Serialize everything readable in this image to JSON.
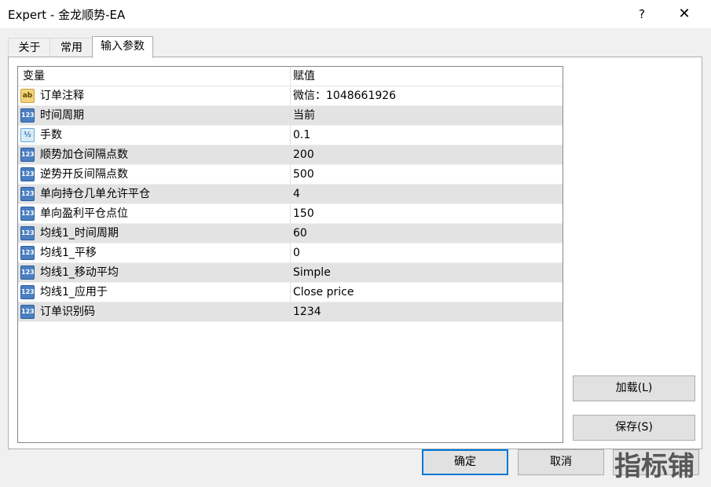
{
  "window": {
    "title": "Expert - 金龙顺势-EA",
    "help_glyph": "?",
    "close_glyph": "✕"
  },
  "tabs": [
    {
      "label": "关于"
    },
    {
      "label": "常用"
    },
    {
      "label": "输入参数",
      "active": true
    }
  ],
  "table": {
    "header": {
      "variable": "变量",
      "value": "赋值"
    },
    "rows": [
      {
        "icon": "string-type-icon",
        "icon_text": "ab",
        "name": "订单注释",
        "value": "微信：1048661926"
      },
      {
        "icon": "integer-type-icon",
        "icon_text": "123",
        "name": "时间周期",
        "value": "当前"
      },
      {
        "icon": "double-type-icon",
        "icon_text": "½",
        "name": "手数",
        "value": "0.1"
      },
      {
        "icon": "integer-type-icon",
        "icon_text": "123",
        "name": "顺势加仓间隔点数",
        "value": "200"
      },
      {
        "icon": "integer-type-icon",
        "icon_text": "123",
        "name": "逆势开反间隔点数",
        "value": "500"
      },
      {
        "icon": "integer-type-icon",
        "icon_text": "123",
        "name": "单向持仓几单允许平仓",
        "value": "4"
      },
      {
        "icon": "integer-type-icon",
        "icon_text": "123",
        "name": "单向盈利平仓点位",
        "value": "150"
      },
      {
        "icon": "integer-type-icon",
        "icon_text": "123",
        "name": "均线1_时间周期",
        "value": "60"
      },
      {
        "icon": "integer-type-icon",
        "icon_text": "123",
        "name": "均线1_平移",
        "value": "0"
      },
      {
        "icon": "integer-type-icon",
        "icon_text": "123",
        "name": "均线1_移动平均",
        "value": "Simple"
      },
      {
        "icon": "integer-type-icon",
        "icon_text": "123",
        "name": "均线1_应用于",
        "value": "Close price"
      },
      {
        "icon": "integer-type-icon",
        "icon_text": "123",
        "name": "订单识别码",
        "value": "1234"
      }
    ]
  },
  "buttons": {
    "load": "加载(L)",
    "save": "保存(S)",
    "ok": "确定",
    "cancel": "取消",
    "reset": "重置"
  },
  "watermark": "指标铺"
}
